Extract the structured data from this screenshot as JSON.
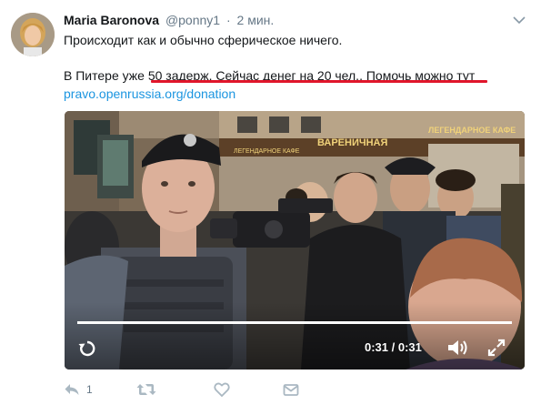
{
  "tweet": {
    "author_name": "Maria Baronova",
    "author_handle": "@ponny1",
    "separator": "·",
    "timestamp": "2 мин.",
    "line1": "Происходит как и обычно сферическое ничего.",
    "line2_prefix": "В Питере уже ",
    "line2_highlight": "50 задерж. Сейчас денег на 20 чел.. Помочь можно тут",
    "link": "pravo.openrussia.org/donation"
  },
  "video": {
    "timecode": "0:31 / 0:31",
    "progress": 1.0,
    "signs": [
      "ВАРЕНИЧНАЯ",
      "ЛЕГЕНДАРНОЕ КАФЕ",
      "ЛЕГЕНДАРНОЕ КАФЕ"
    ]
  },
  "actions": {
    "reply_count": "1"
  },
  "icons": {
    "chevron": "chevron-down-icon",
    "replay": "replay-icon",
    "volume": "volume-icon",
    "fullscreen": "fullscreen-icon",
    "reply": "reply-icon",
    "retweet": "retweet-icon",
    "like": "heart-icon",
    "dm": "envelope-icon"
  },
  "colors": {
    "link": "#1b95e0",
    "highlight_underline": "#e0162b",
    "action_icon": "#aab8c2"
  }
}
